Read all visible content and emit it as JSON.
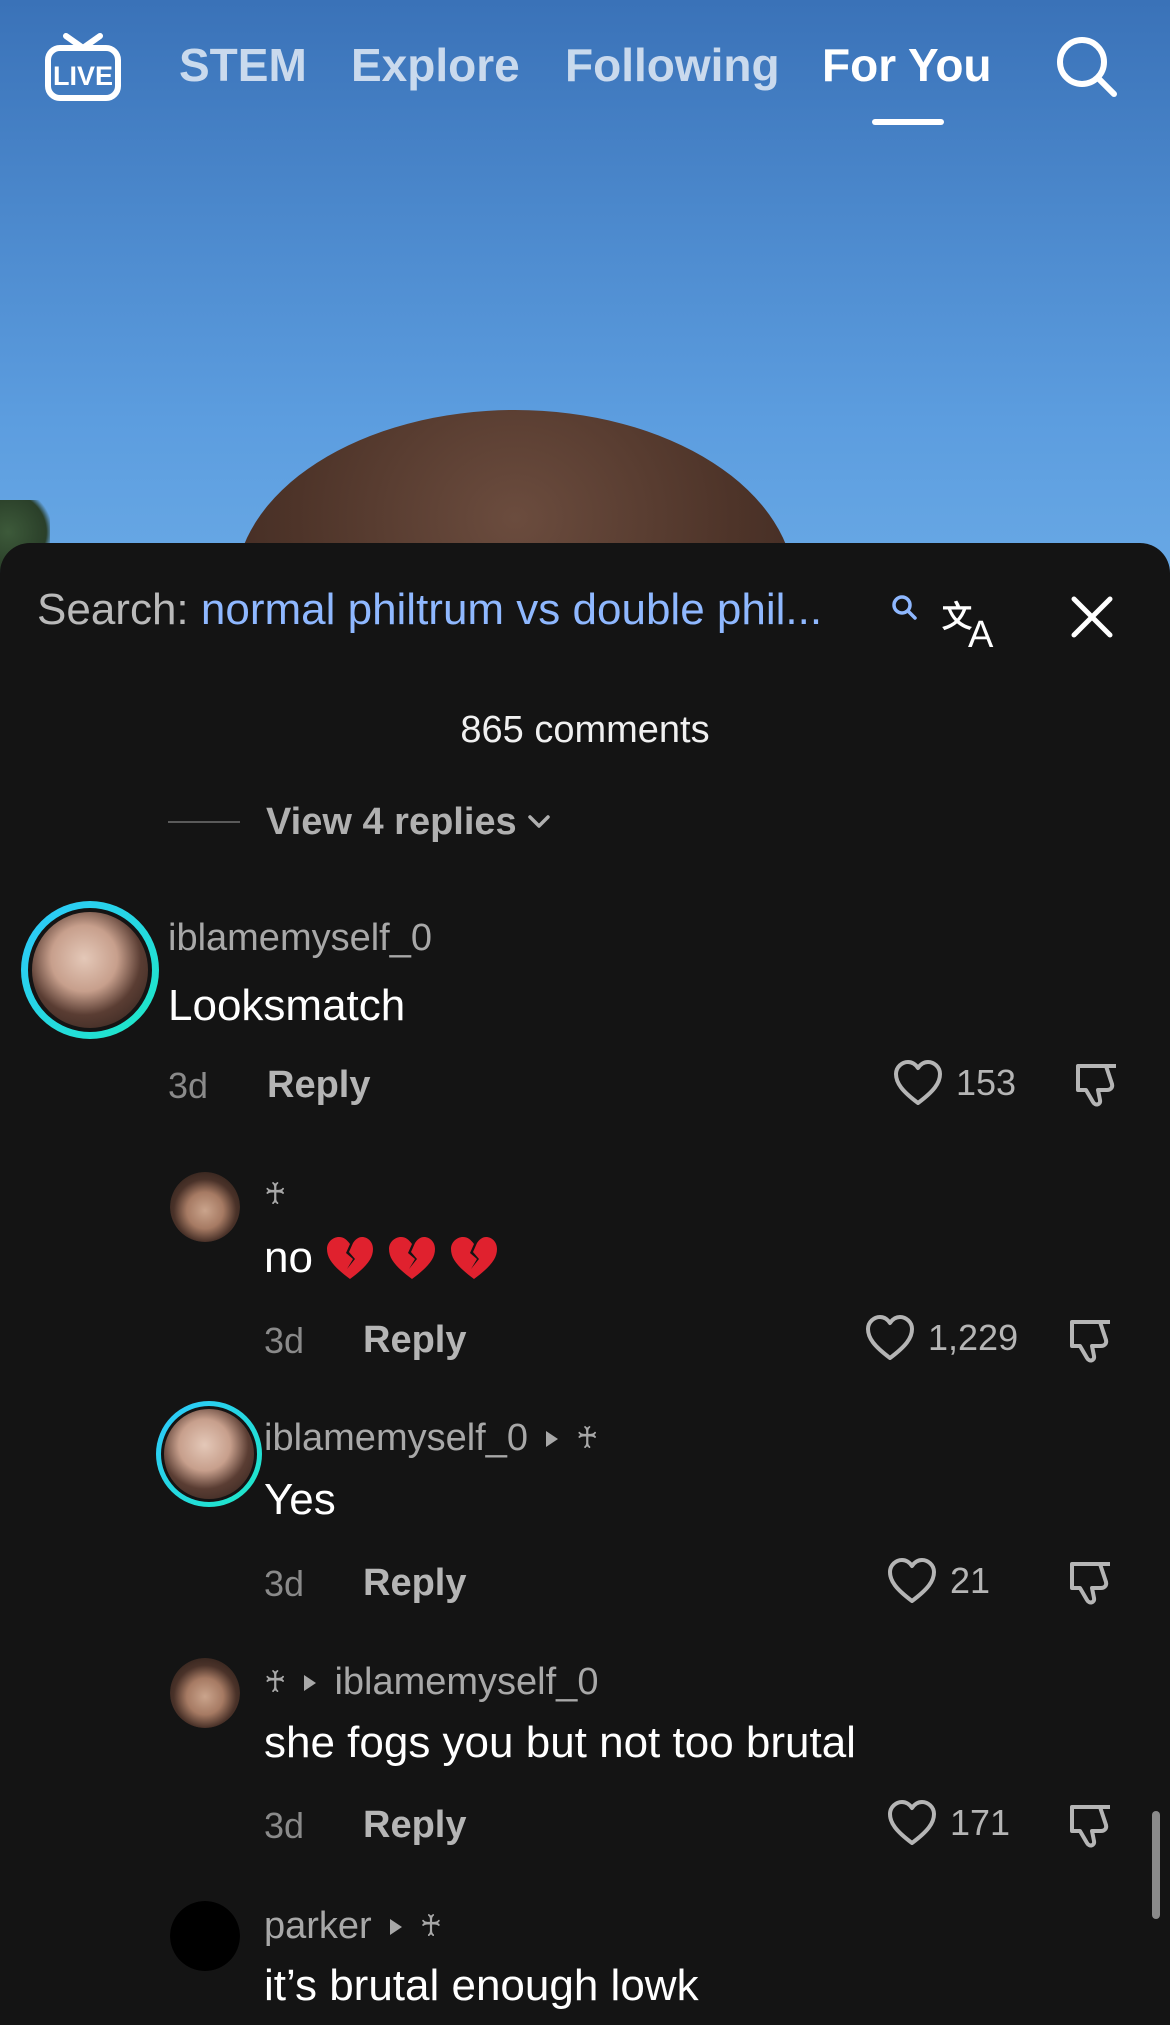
{
  "nav": {
    "live_icon": "live-tv-icon",
    "tabs": [
      {
        "label": "STEM"
      },
      {
        "label": "Explore"
      },
      {
        "label": "Following"
      },
      {
        "label": "For You",
        "active": true
      }
    ],
    "search_icon": "search-icon"
  },
  "sheet": {
    "search_prefix": "Search:",
    "search_query": "normal philtrum vs double phil...",
    "comment_count": "865 comments",
    "view_replies": "View 4 replies"
  },
  "comments": [
    {
      "username": "iblamemyself_0",
      "text": "Looksmatch",
      "time": "3d",
      "reply": "Reply",
      "likes": "153",
      "avatar_ring": true
    },
    {
      "username": "♰",
      "text": "no",
      "emoji": "broken-heart-emoji x3",
      "time": "3d",
      "reply": "Reply",
      "likes": "1,229"
    },
    {
      "username": "iblamemyself_0",
      "reply_to": "♰",
      "text": "Yes",
      "time": "3d",
      "reply": "Reply",
      "likes": "21",
      "avatar_ring": true
    },
    {
      "username": "♰",
      "reply_to": "iblamemyself_0",
      "text": "she fogs you but not too brutal",
      "time": "3d",
      "reply": "Reply",
      "likes": "171"
    },
    {
      "username": "parker",
      "reply_to": "♰",
      "text": "it’s brutal enough lowk"
    }
  ],
  "colors": {
    "accent_link": "#8fb8ff",
    "avatar_ring": "#2ec7ff",
    "sheet_bg": "#141414"
  }
}
